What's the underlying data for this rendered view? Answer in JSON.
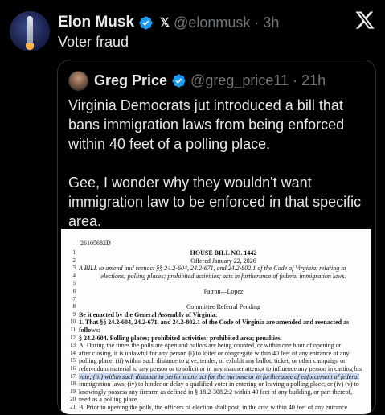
{
  "tweet": {
    "author_name": "Elon Musk",
    "x_glyph": "𝕏",
    "handle_time": "@elonmusk · 3h",
    "text": "Voter fraud",
    "verified_color": "#1d9bf0"
  },
  "quote": {
    "author_name": "Greg Price",
    "handle_time": "@greg_price11 · 21h",
    "paragraphs": [
      "Virginia Democrats jut introduced a bill that bans immigration laws from being enforced within 40 feet of a polling place.",
      "Gee, I wonder why they wouldn't want immigration law to be enforced in that specific area."
    ]
  },
  "document": {
    "code": "26105682D",
    "lines": [
      {
        "num": "1",
        "text": "HOUSE BILL NO. 1442",
        "style": "center b"
      },
      {
        "num": "2",
        "text": "Offered January 22, 2026",
        "style": "center"
      },
      {
        "num": "3",
        "text": "A BILL to amend and reenact §§ 24.2-604, 24.2-671, and 24.2-802.1 of the Code of Virginia, relating to",
        "style": "i"
      },
      {
        "num": "4",
        "text": "elections; polling places; prohibited activities; acts in furtherance of federal immigration laws.",
        "style": "center i"
      },
      {
        "num": "5",
        "text": "",
        "style": ""
      },
      {
        "num": "6",
        "text": "Patron—Lopez",
        "style": "center"
      },
      {
        "num": "7",
        "text": "",
        "style": ""
      },
      {
        "num": "8",
        "text": "Committee Referral Pending",
        "style": "center"
      },
      {
        "num": "9",
        "text": "Be it enacted by the General Assembly of Virginia:",
        "style": "b"
      },
      {
        "num": "10",
        "text": "1. That §§ 24.2-604, 24.2-671, and 24.2-802.1 of the Code of Virginia are amended and reenacted as",
        "style": "b"
      },
      {
        "num": "11",
        "text": "follows:",
        "style": "b"
      },
      {
        "num": "12",
        "text": "§ 24.2-604. Polling places; prohibited activities; prohibited area; penalties.",
        "style": "b"
      },
      {
        "num": "13",
        "text": "A. During the times the polls are open and ballots are being counted, or within one hour of opening or",
        "style": ""
      },
      {
        "num": "14",
        "text": "after closing, it is unlawful for any person (i) to loiter or congregate within 40 feet of any entrance of any",
        "style": ""
      },
      {
        "num": "15",
        "text": "polling place; (ii) within such distance to give, tender, or exhibit any ballot, ticket, or other campaign or",
        "style": ""
      },
      {
        "num": "16",
        "text": "referendum material to any person or to solicit or in any manner attempt to influence any person in casting his",
        "style": ""
      },
      {
        "num": "17",
        "text": "vote; (iii) within such distance to perform any act for the purpose or in furtherance of enforcement of federal",
        "style": "hl"
      },
      {
        "num": "18",
        "text": "immigration laws; (iv) to hinder or delay a qualified voter in entering or leaving a polling place; or (iv) (v) to",
        "style": ""
      },
      {
        "num": "19",
        "text": "knowingly possess any firearm as defined in § 18.2-308.2:2 within 40 feet of any building, or part thereof,",
        "style": ""
      },
      {
        "num": "20",
        "text": "used as a polling place.",
        "style": ""
      },
      {
        "num": "21",
        "text": "B. Prior to opening the polls, the officers of election shall post, in the area within 40 feet of any entrance",
        "style": ""
      }
    ]
  }
}
